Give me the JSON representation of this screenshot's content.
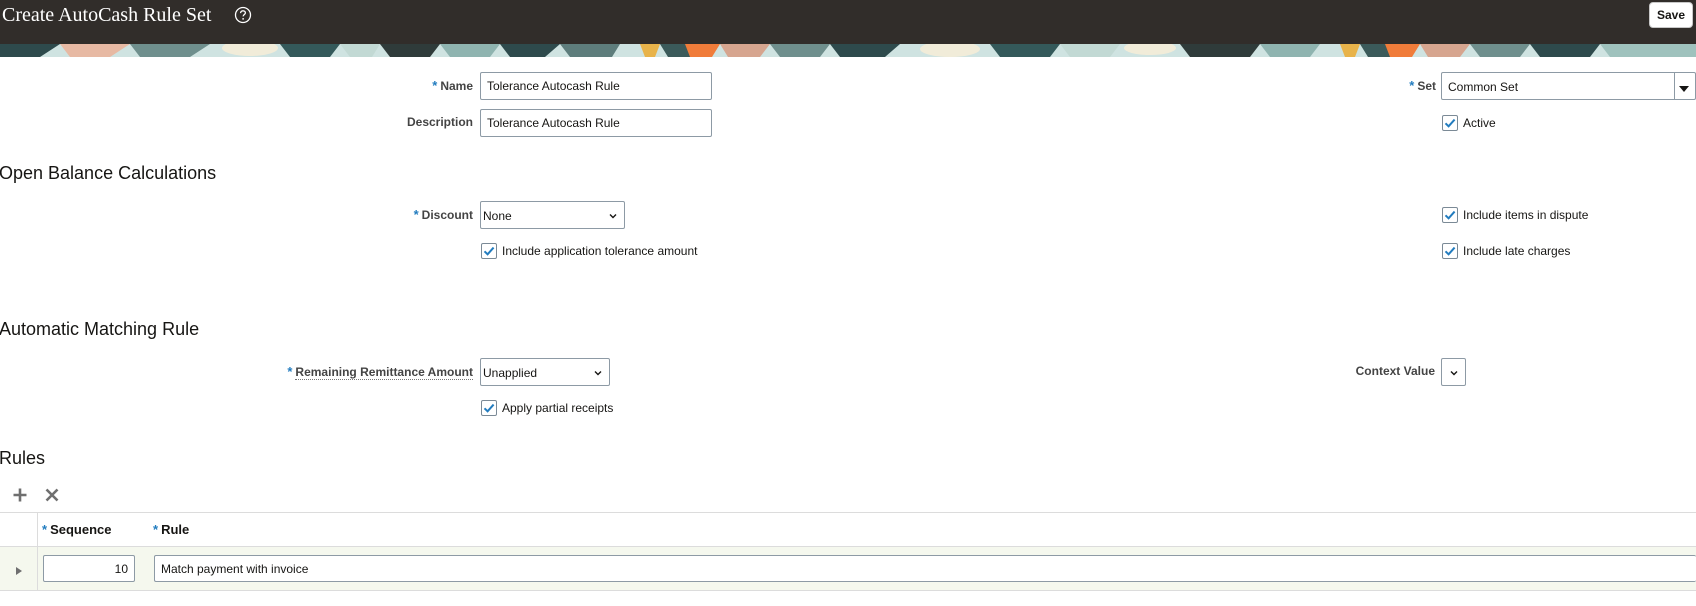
{
  "header": {
    "title": "Create AutoCash Rule Set",
    "help_icon": "help-circle-icon",
    "save_label": "Save"
  },
  "form": {
    "name": {
      "label": "Name",
      "value": "Tolerance Autocash Rule",
      "required": true
    },
    "description": {
      "label": "Description",
      "value": "Tolerance Autocash Rule"
    },
    "set": {
      "label": "Set",
      "value": "Common Set",
      "required": true
    },
    "active": {
      "label": "Active",
      "checked": true
    }
  },
  "open_balance": {
    "heading": "Open Balance Calculations",
    "discount": {
      "label": "Discount",
      "value": "None",
      "required": true
    },
    "include_tolerance": {
      "label": "Include application tolerance amount",
      "checked": true
    },
    "include_dispute": {
      "label": "Include items in dispute",
      "checked": true
    },
    "include_late": {
      "label": "Include late charges",
      "checked": true
    }
  },
  "matching": {
    "heading": "Automatic Matching Rule",
    "remaining": {
      "label": "Remaining Remittance Amount",
      "value": "Unapplied",
      "required": true
    },
    "context": {
      "label": "Context Value",
      "value": ""
    },
    "partial": {
      "label": "Apply partial receipts",
      "checked": true
    }
  },
  "rules": {
    "heading": "Rules",
    "add_icon": "plus-icon",
    "delete_icon": "x-icon",
    "columns": [
      "Sequence",
      "Rule"
    ],
    "rows": [
      {
        "sequence": "10",
        "rule": "Match payment with invoice"
      }
    ]
  },
  "colors": {
    "header_bg": "#312d2a",
    "required_marker": "#227cbf",
    "checkbox_check": "#227cbf",
    "row_highlight": "#f5f8ee"
  }
}
